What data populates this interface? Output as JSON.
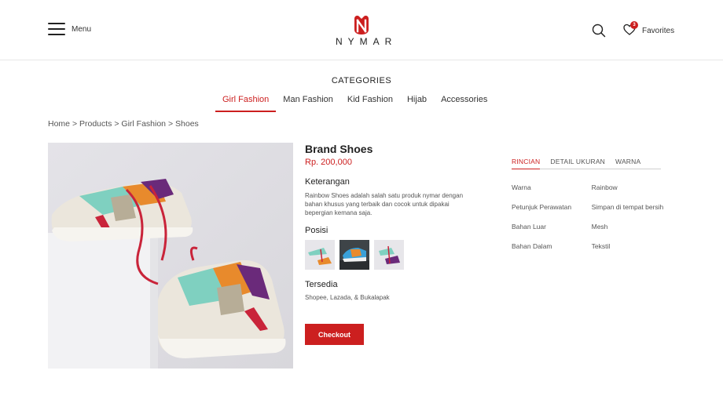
{
  "header": {
    "menu_label": "Menu",
    "logo_text": "NYMAR",
    "favorites_label": "Favorites",
    "favorites_count": "3"
  },
  "categories": {
    "title": "CATEGORIES",
    "items": [
      {
        "label": "Girl Fashion",
        "active": true
      },
      {
        "label": "Man Fashion",
        "active": false
      },
      {
        "label": "Kid Fashion",
        "active": false
      },
      {
        "label": "Hijab",
        "active": false
      },
      {
        "label": "Accessories",
        "active": false
      }
    ]
  },
  "breadcrumb": {
    "items": [
      "Home",
      "Products",
      "Girl Fashion",
      "Shoes"
    ],
    "separator": ">"
  },
  "product": {
    "name": "Brand Shoes",
    "price": "Rp. 200,000",
    "description_title": "Keterangan",
    "description": "Rainbow Shoes adalah salah satu produk nymar dengan bahan khusus yang terbaik dan cocok untuk dipakai bepergian kemana saja.",
    "position_title": "Posisi",
    "available_title": "Tersedia",
    "available_text": "Shopee, Lazada, & Bukalapak",
    "checkout_label": "Checkout"
  },
  "info_tabs": {
    "tabs": [
      {
        "label": "RINCIAN",
        "active": true
      },
      {
        "label": "DETAIL UKURAN",
        "active": false
      },
      {
        "label": "WARNA",
        "active": false
      }
    ],
    "specs": [
      {
        "key": "Warna",
        "value": "Rainbow"
      },
      {
        "key": "Petunjuk Perawatan",
        "value": "Simpan di tempat bersih"
      },
      {
        "key": "Bahan Luar",
        "value": "Mesh"
      },
      {
        "key": "Bahan Dalam",
        "value": "Tekstil"
      }
    ]
  },
  "colors": {
    "accent": "#cc1f1f",
    "text": "#222222",
    "muted": "#555555",
    "border": "#e6e6e6"
  }
}
